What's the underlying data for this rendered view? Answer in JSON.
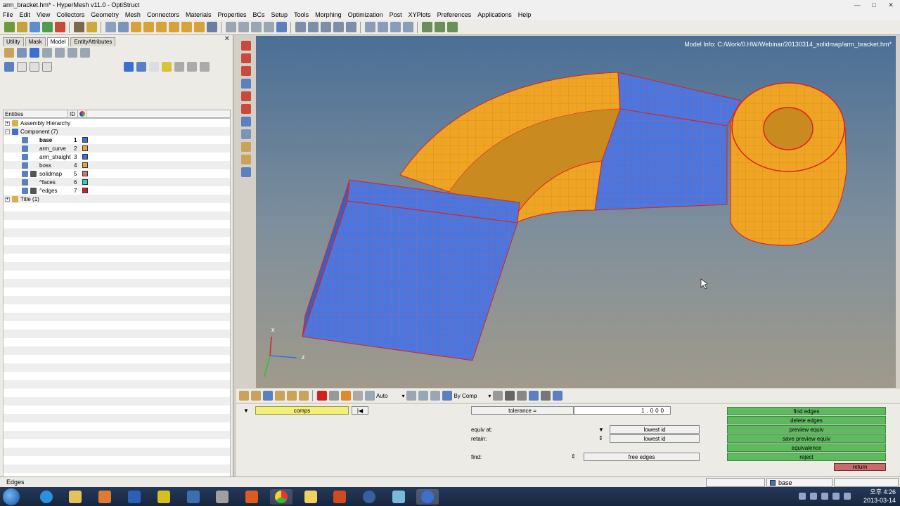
{
  "window": {
    "title": "arm_bracket.hm* - HyperMesh v11.0 - OptiStruct",
    "min": "—",
    "max": "□",
    "close": "✕"
  },
  "menu": [
    "File",
    "Edit",
    "View",
    "Collectors",
    "Geometry",
    "Mesh",
    "Connectors",
    "Materials",
    "Properties",
    "BCs",
    "Setup",
    "Tools",
    "Morphing",
    "Optimization",
    "Post",
    "XYPlots",
    "Preferences",
    "Applications",
    "Help"
  ],
  "left_panel": {
    "tabs": [
      "Utility",
      "Mask",
      "Model",
      "EntityAttributes"
    ],
    "active_tab": "Model",
    "close_glyph": "✕",
    "columns": {
      "entities": "Entities",
      "id": "ID"
    },
    "tree": {
      "assembly": "Assembly Hierarchy",
      "component_group": "Component (7)",
      "components": [
        {
          "name": "base",
          "id": "1",
          "color": "#3b6fd6"
        },
        {
          "name": "arm_curve",
          "id": "2",
          "color": "#f0a424"
        },
        {
          "name": "arm_straight",
          "id": "3",
          "color": "#3b6fd6"
        },
        {
          "name": "boss",
          "id": "4",
          "color": "#f0a424"
        },
        {
          "name": "solidmap",
          "id": "5",
          "color": "#c87a6a"
        },
        {
          "name": "^faces",
          "id": "6",
          "color": "#2ad1d1"
        },
        {
          "name": "^edges",
          "id": "7",
          "color": "#d62020"
        }
      ],
      "title_group": "Title (1)"
    }
  },
  "viewport": {
    "model_info": "Model Info: C:/Work/0.HW/Webinar/20130314_solidmap/arm_bracket.hm*",
    "axis_x": "x",
    "axis_z": "z"
  },
  "bottombar": {
    "auto": "Auto",
    "by_comp": "By Comp"
  },
  "panel": {
    "comps": "comps",
    "tolerance_label": "tolerance =",
    "tolerance_value": "1.000",
    "equiv_at_label": "equiv at:",
    "equiv_at_value": "lowest id",
    "retain_label": "retain:",
    "retain_value": "lowest id",
    "find_label": "find:",
    "find_value": "free edges",
    "actions": [
      "find edges",
      "delete edges",
      "preview equiv",
      "save preview equiv",
      "equivalence",
      "reject"
    ],
    "return": "return"
  },
  "status": {
    "text": "Edges",
    "component": "base"
  },
  "tray": {
    "time": "오후 4:26",
    "date": "2013-03-14"
  },
  "colors": {
    "base": "#3b6fd6",
    "arm_curve": "#f0a424",
    "edges": "#e0201a",
    "green_button": "#5fba5f",
    "return_button": "#c96b6b"
  }
}
